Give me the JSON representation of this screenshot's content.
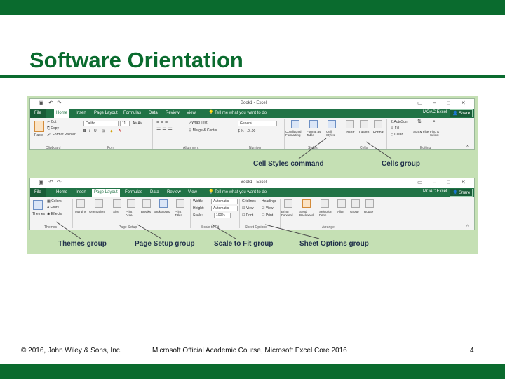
{
  "slide": {
    "title": "Software Orientation",
    "footer_left": "© 2016, John Wiley & Sons, Inc.",
    "footer_center": "Microsoft Official Academic Course, Microsoft Excel Core 2016",
    "page_number": "4",
    "colors": {
      "brand": "#0a6b2e",
      "panel": "#c5e0b4",
      "ribbon_tab_bar": "#217346",
      "callout_text": "#1f2f4a"
    }
  },
  "ribbon_home": {
    "window_title": "Book1 - Excel",
    "tabs": [
      "File",
      "Home",
      "Insert",
      "Page Layout",
      "Formulas",
      "Data",
      "Review",
      "View"
    ],
    "tell_me": "Tell me what you want to do",
    "account": "MOAC Excel",
    "share": "Share",
    "clipboard": {
      "paste": "Paste",
      "cut": "Cut",
      "copy": "Copy",
      "format_painter": "Format Painter",
      "label": "Clipboard"
    },
    "font": {
      "name": "Calibri",
      "size": "11",
      "label": "Font"
    },
    "alignment": {
      "wrap_text": "Wrap Text",
      "merge_center": "Merge & Center",
      "label": "Alignment"
    },
    "number": {
      "format": "General",
      "label": "Number"
    },
    "styles": {
      "conditional": "Conditional Formatting",
      "format_table": "Format as Table",
      "cell_styles": "Cell Styles",
      "label": "Styles"
    },
    "cells": {
      "insert": "Insert",
      "delete": "Delete",
      "format": "Format",
      "label": "Cells"
    },
    "editing": {
      "autosum": "AutoSum",
      "fill": "Fill",
      "clear": "Clear",
      "sort_filter": "Sort & Filter",
      "find_select": "Find & Select",
      "label": "Editing"
    }
  },
  "ribbon_page_layout": {
    "window_title": "Book1 - Excel",
    "tabs": [
      "File",
      "Home",
      "Insert",
      "Page Layout",
      "Formulas",
      "Data",
      "Review",
      "View"
    ],
    "tell_me": "Tell me what you want to do",
    "account": "MOAC Excel",
    "share": "Share",
    "themes": {
      "themes": "Themes",
      "colors": "Colors",
      "fonts": "Fonts",
      "effects": "Effects",
      "label": "Themes"
    },
    "page_setup": {
      "margins": "Margins",
      "orientation": "Orientation",
      "size": "Size",
      "print_area": "Print Area",
      "breaks": "Breaks",
      "background": "Background",
      "print_titles": "Print Titles",
      "label": "Page Setup"
    },
    "scale_to_fit": {
      "width": "Width:",
      "width_value": "Automatic",
      "height": "Height:",
      "height_value": "Automatic",
      "scale": "Scale:",
      "scale_value": "100%",
      "label": "Scale to Fit"
    },
    "sheet_options": {
      "gridlines": "Gridlines",
      "headings": "Headings",
      "view": "View",
      "print": "Print",
      "label": "Sheet Options"
    },
    "arrange": {
      "bring_forward": "Bring Forward",
      "send_backward": "Send Backward",
      "selection_pane": "Selection Pane",
      "align": "Align",
      "group": "Group",
      "rotate": "Rotate",
      "label": "Arrange"
    }
  },
  "callouts": {
    "cell_styles": "Cell Styles command",
    "cells_group": "Cells group",
    "themes_group": "Themes group",
    "page_setup_group": "Page Setup group",
    "scale_to_fit_group": "Scale to Fit group",
    "sheet_options_group": "Sheet Options group"
  }
}
